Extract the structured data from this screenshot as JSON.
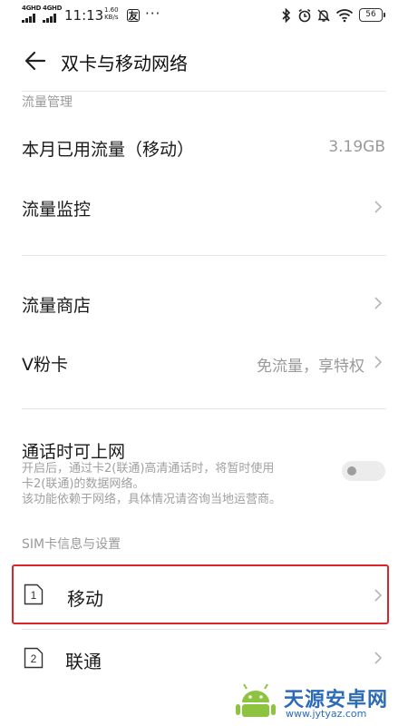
{
  "status_bar": {
    "sim1_label": "4GHD",
    "sim2_label": "4GHD",
    "time": "11:13",
    "speed_value": "1.60",
    "speed_unit": "KB/s",
    "app_icon_text": "友",
    "more": "···",
    "battery": "56",
    "icons": [
      "bluetooth-icon",
      "alarm-icon",
      "mute-icon",
      "wifi-icon",
      "battery-icon"
    ]
  },
  "header": {
    "title": "双卡与移动网络",
    "back_icon": "arrow-left-icon"
  },
  "data_management": {
    "section_label": "流量管理",
    "monthly_usage_label": "本月已用流量（移动）",
    "monthly_usage_value": "3.19GB",
    "monitor_label": "流量监控",
    "store_label": "流量商店",
    "vcard_label": "V粉卡",
    "vcard_value": "免流量，享特权"
  },
  "call_data": {
    "label": "通话时可上网",
    "desc_line1": "开启后，通过卡2(联通)高清通话时，将暂时使用",
    "desc_line2": "卡2(联通)的数据网络。",
    "desc_line3": "该功能依赖于网络，具体情况请咨询当地运营商。",
    "enabled": false
  },
  "sim_section": {
    "section_label": "SIM卡信息与设置",
    "sims": [
      {
        "slot": "1",
        "name": "移动",
        "selected": true
      },
      {
        "slot": "2",
        "name": "联通",
        "selected": false
      }
    ]
  },
  "watermark": {
    "title": "天源安卓网",
    "url": "www.jytyaz.com",
    "icon": "android-logo-icon"
  },
  "colors": {
    "highlight": "#d9262c",
    "secondary_text": "#9a9a9a",
    "watermark": "#2b6bb8"
  }
}
